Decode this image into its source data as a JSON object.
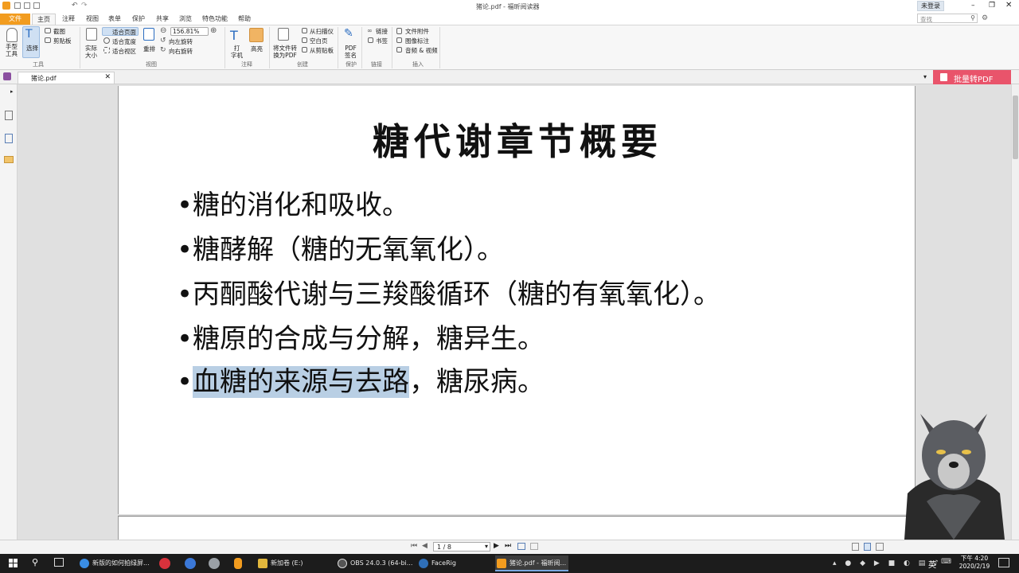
{
  "window": {
    "title": "猪论.pdf - 福昕阅读器",
    "login": "未登录",
    "search_placeholder": "查找"
  },
  "ribbon_tabs": [
    "文件",
    "主页",
    "注释",
    "视图",
    "表单",
    "保护",
    "共享",
    "浏览",
    "特色功能",
    "帮助"
  ],
  "ribbon": {
    "hand_tool": "手型\n工具",
    "select": "选择",
    "tools_group": "工具",
    "snapshot": "截图",
    "clipboard": "剪贴板",
    "fit_page": "适合页面",
    "fit_width": "适合宽度",
    "fit_visible": "适合视区",
    "actual_size": "实际\n大小",
    "reflow": "重排",
    "zoom_value": "156.81%",
    "rotate_left": "向左旋转",
    "rotate_right": "向右旋转",
    "view_group": "视图",
    "typewriter": "打\n字机",
    "highlight": "高亮",
    "comment_group": "注释",
    "convert": "将文件转\n换为PDF",
    "from_scanner": "从扫描仪",
    "blank_page": "空白页",
    "from_clipboard": "从剪贴板",
    "create_group": "创建",
    "pdf_sign": "PDF\n签名",
    "protect_group": "保护",
    "link": "链接",
    "bookmark": "书签",
    "links_group": "链接",
    "file_attachment": "文件附件",
    "image_annotation": "图像标注",
    "audio_video": "音频 & 视频",
    "insert_group": "插入"
  },
  "doc_tab": "猪论.pdf",
  "batch_convert": "批量转PDF",
  "slide": {
    "title": "糖代谢章节概要",
    "bullets": [
      "•糖的消化和吸收。",
      "•糖酵解（糖的无氧氧化）。",
      "•丙酮酸代谢与三羧酸循环（糖的有氧氧化）。",
      "•糖原的合成与分解，糖异生。"
    ],
    "last_bullet_dot": "•",
    "last_bullet_highlighted": "血糖的来源与去路",
    "last_bullet_rest": "，糖尿病。"
  },
  "status": {
    "page_indicator": "1 / 8"
  },
  "taskbar": {
    "items": [
      "新版的如何拍绿屏...",
      "新加卷 (E:)",
      "OBS 24.0.3 (64-bi...",
      "FaceRig",
      "猪论.pdf - 福昕阅..."
    ],
    "time": "下午 4:20",
    "date": "2020/2/19",
    "lang": "英"
  },
  "colors": {
    "accent": "#f29c1f",
    "batch_button": "#e9546b",
    "highlight": "#b9cfe4"
  }
}
